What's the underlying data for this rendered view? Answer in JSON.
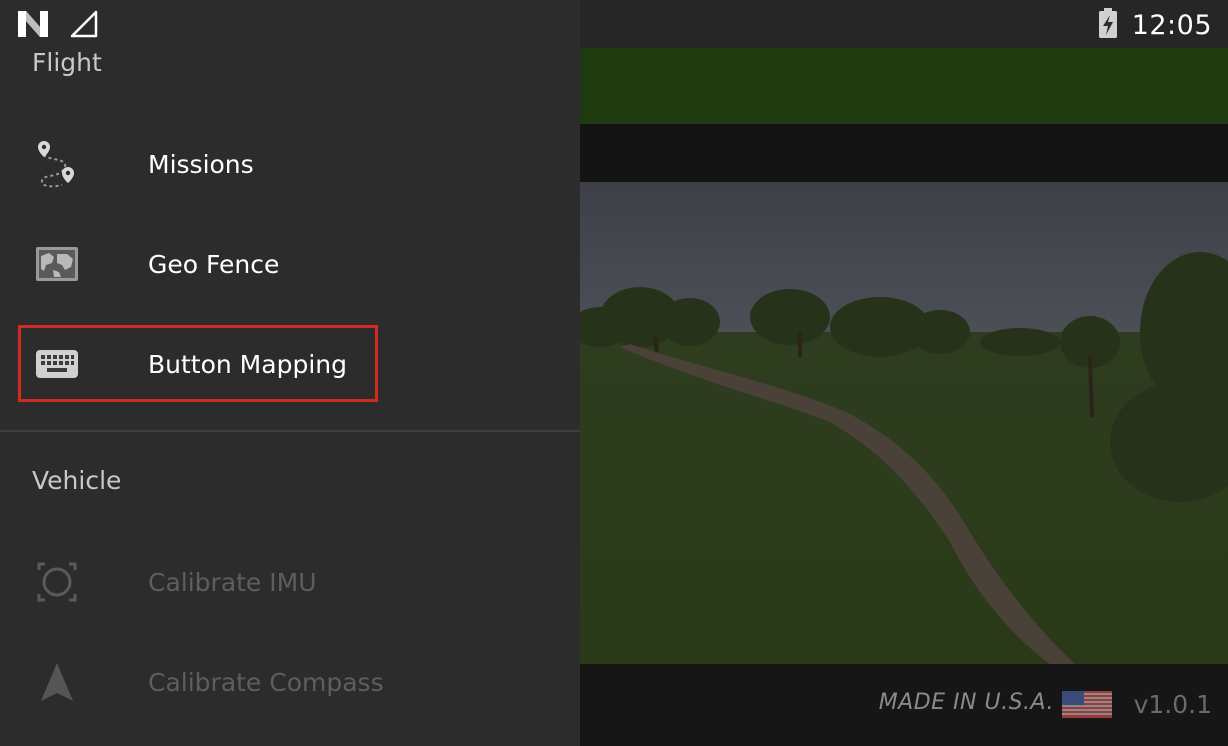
{
  "status_bar": {
    "time": "12:05",
    "left_icons": [
      "app-n-icon",
      "signal-icon"
    ],
    "right_icons": [
      "battery-charging-icon"
    ]
  },
  "drawer": {
    "flight_section": {
      "title": "Flight",
      "items": [
        {
          "label": "Missions",
          "icon": "route-pins-icon",
          "enabled": true
        },
        {
          "label": "Geo Fence",
          "icon": "map-icon",
          "enabled": true
        },
        {
          "label": "Button Mapping",
          "icon": "keyboard-icon",
          "enabled": true,
          "highlighted": true
        }
      ]
    },
    "vehicle_section": {
      "title": "Vehicle",
      "items": [
        {
          "label": "Calibrate IMU",
          "icon": "imu-frame-icon",
          "enabled": false
        },
        {
          "label": "Calibrate Compass",
          "icon": "compass-arrow-icon",
          "enabled": false
        }
      ]
    }
  },
  "footer": {
    "made_in": "MADE IN U.S.A.",
    "version": "v1.0.1"
  },
  "colors": {
    "drawer_bg": "#2c2c2c",
    "highlight_border": "#d12a20",
    "green_bar": "#1e3a0e",
    "disabled_text": "#5e5e5e"
  }
}
